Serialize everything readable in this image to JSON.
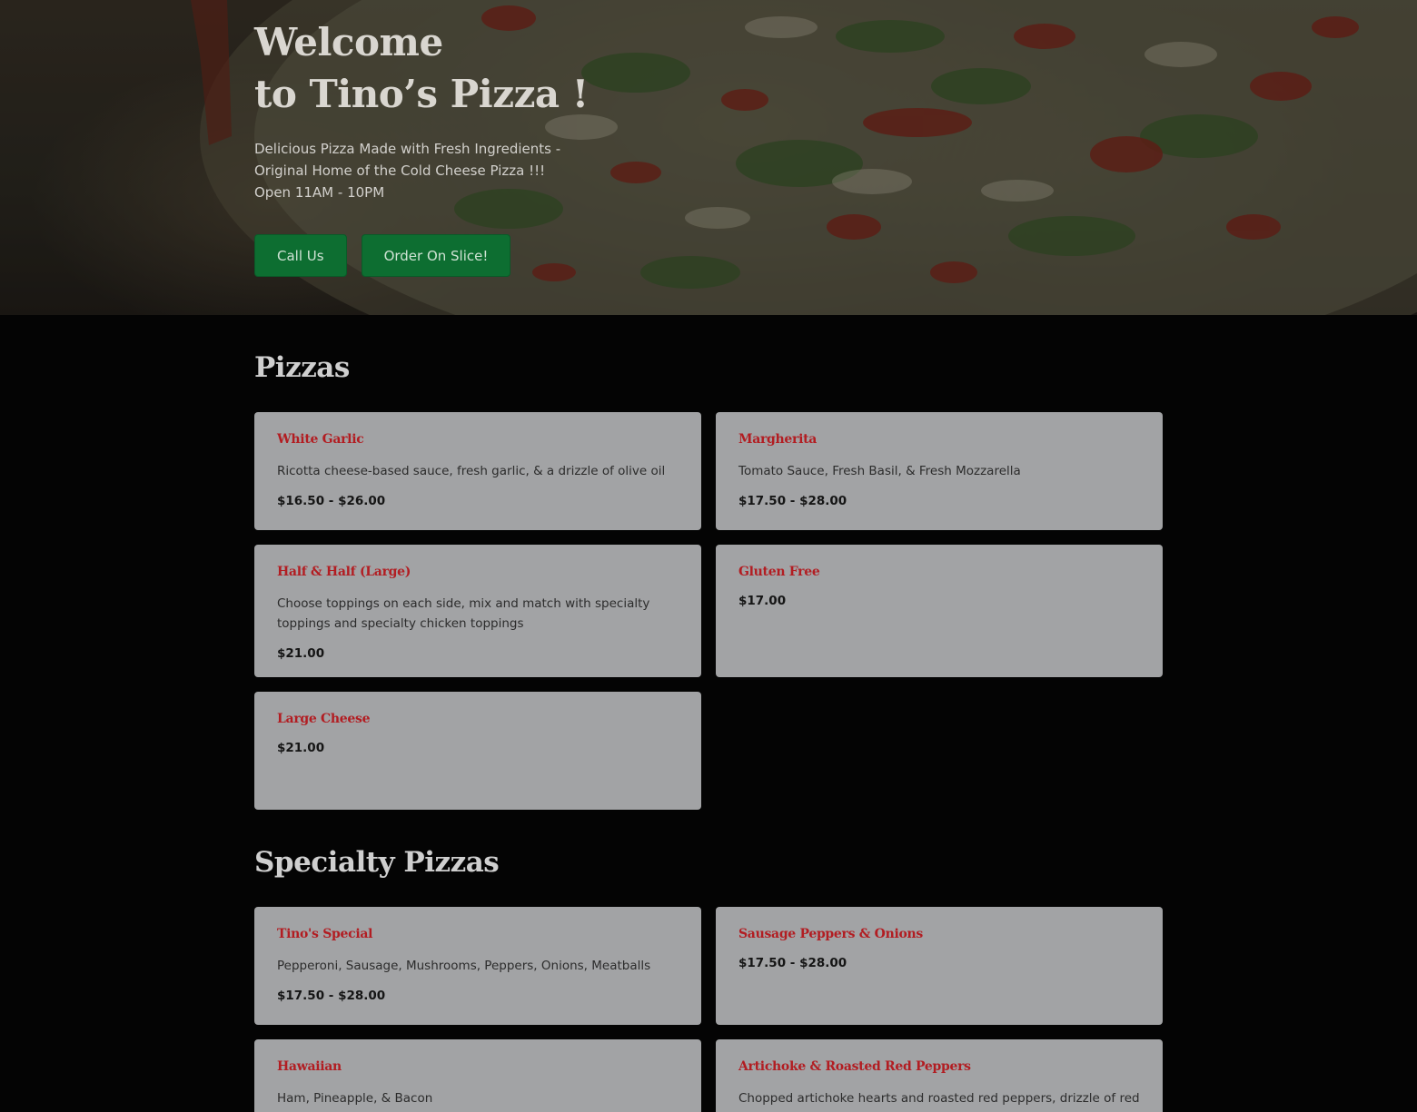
{
  "hero": {
    "title_line1": "Welcome",
    "title_line2": "to Tino’s Pizza !",
    "subtitle_line1": "Delicious Pizza Made with Fresh Ingredients -",
    "subtitle_line2": "Original Home of the Cold Cheese Pizza !!!",
    "hours": "Open 11AM - 10PM",
    "call_button": "Call Us",
    "order_button": "Order On Slice!"
  },
  "colors": {
    "accent_green": "#0d6e31",
    "item_name_red": "#b21d22",
    "card_gray": "#a2a3a5",
    "page_background": "#040404"
  },
  "sections": [
    {
      "title": "Pizzas",
      "items": [
        {
          "name": "White Garlic",
          "desc": "Ricotta cheese-based sauce, fresh garlic, & a drizzle of olive oil",
          "price": "$16.50 - $26.00"
        },
        {
          "name": "Margherita",
          "desc": "Tomato Sauce, Fresh Basil, & Fresh Mozzarella",
          "price": "$17.50 - $28.00"
        },
        {
          "name": "Half & Half (Large)",
          "desc": "Choose toppings on each side, mix and match with specialty toppings and specialty chicken toppings",
          "price": "$21.00"
        },
        {
          "name": "Gluten Free",
          "desc": "",
          "price": "$17.00"
        },
        {
          "name": "Large Cheese",
          "desc": "",
          "price": "$21.00"
        }
      ]
    },
    {
      "title": "Specialty Pizzas",
      "items": [
        {
          "name": "Tino's Special",
          "desc": "Pepperoni, Sausage, Mushrooms, Peppers, Onions, Meatballs",
          "price": "$17.50 - $28.00"
        },
        {
          "name": "Sausage Peppers & Onions",
          "desc": "",
          "price": "$17.50 - $28.00"
        },
        {
          "name": "Hawaiian",
          "desc": "Ham, Pineapple, & Bacon",
          "price": ""
        },
        {
          "name": "Artichoke & Roasted Red Peppers",
          "desc": "Chopped artichoke hearts and roasted red peppers, drizzle of red",
          "price": ""
        }
      ]
    }
  ]
}
